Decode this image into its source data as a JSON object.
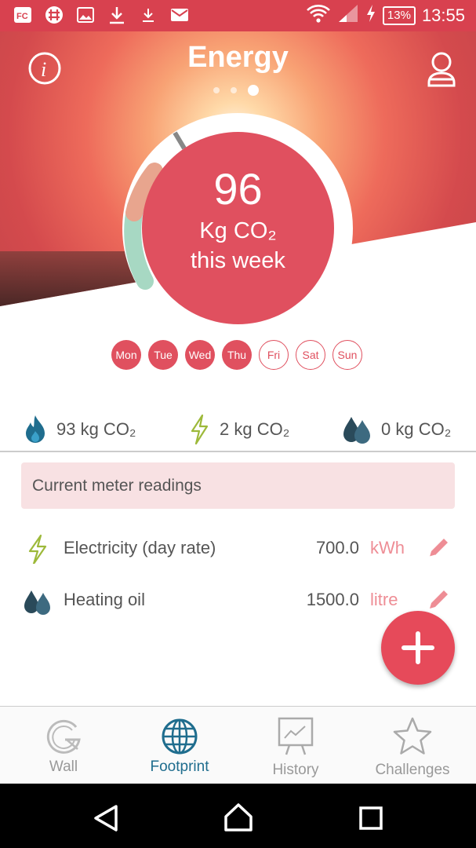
{
  "status_bar": {
    "time": "13:55",
    "battery": "13%",
    "icons": [
      "fk-app-icon",
      "slack-icon",
      "image-icon",
      "download-icon",
      "download-small-icon",
      "mail-icon",
      "wifi-icon",
      "signal-icon",
      "charging-icon"
    ]
  },
  "header": {
    "title": "Energy",
    "page_indicator": {
      "count": 3,
      "active_index": 2
    }
  },
  "gauge": {
    "value": "96",
    "unit_line": "Kg CO₂",
    "period_line": "this week",
    "colors": {
      "center": "#e0505f",
      "ring_bg": "#ffffff",
      "segment_heating": "#e8a58e",
      "segment_green": "#a7d8c3",
      "marker": "#888888"
    }
  },
  "days": [
    {
      "label": "Mon",
      "active": true
    },
    {
      "label": "Tue",
      "active": true
    },
    {
      "label": "Wed",
      "active": true
    },
    {
      "label": "Thu",
      "active": true
    },
    {
      "label": "Fri",
      "active": false
    },
    {
      "label": "Sat",
      "active": false
    },
    {
      "label": "Sun",
      "active": false
    }
  ],
  "summary": [
    {
      "icon": "flame-icon",
      "text": "93 kg CO₂"
    },
    {
      "icon": "lightning-icon",
      "text": "2 kg CO₂"
    },
    {
      "icon": "oil-drops-icon",
      "text": "0 kg CO₂"
    }
  ],
  "meter_readings": {
    "header": "Current meter readings",
    "items": [
      {
        "icon": "lightning-icon",
        "label": "Electricity (day rate)",
        "value": "700.0",
        "unit": "kWh"
      },
      {
        "icon": "oil-drops-icon",
        "label": "Heating oil",
        "value": "1500.0",
        "unit": "litre"
      }
    ]
  },
  "fab": {
    "icon": "plus-icon"
  },
  "bottom_nav": [
    {
      "label": "Wall",
      "icon": "wall-g-icon",
      "active": false
    },
    {
      "label": "Footprint",
      "icon": "globe-icon",
      "active": true
    },
    {
      "label": "History",
      "icon": "chart-board-icon",
      "active": false
    },
    {
      "label": "Challenges",
      "icon": "star-icon",
      "active": false
    }
  ],
  "colors": {
    "accent": "#e0505f",
    "active_nav": "#1f6d8e",
    "statusbar": "#d8414f",
    "unit_text": "#ee8d95"
  }
}
